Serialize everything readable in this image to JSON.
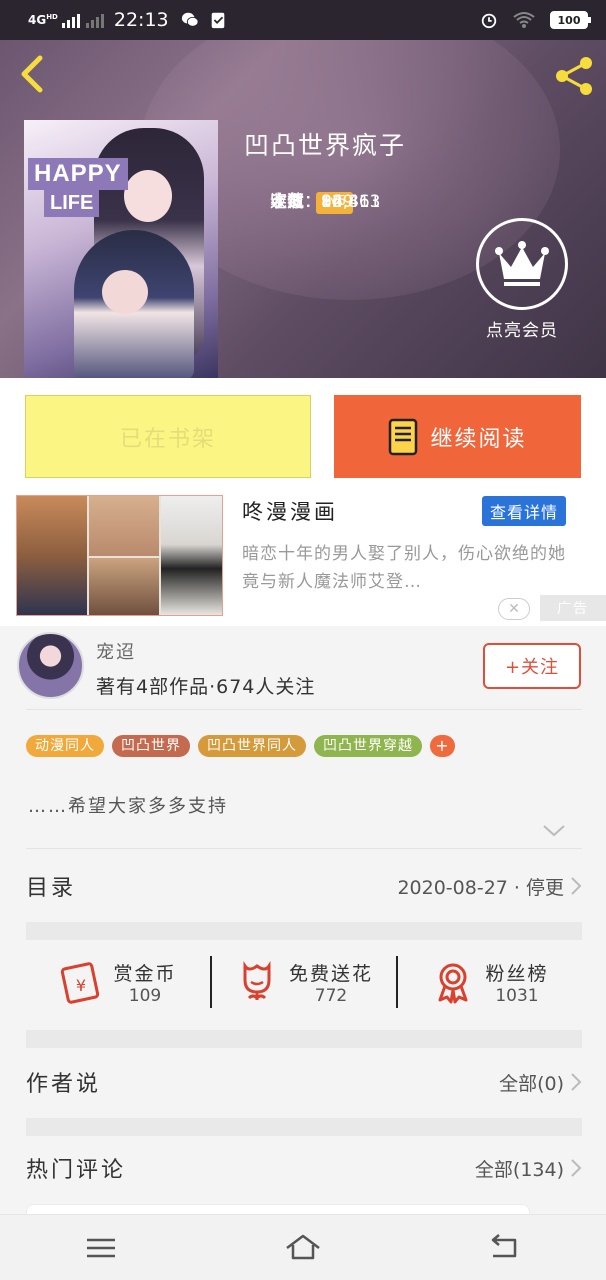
{
  "status_bar": {
    "network": "4G",
    "network_sup": "HD",
    "time": "22:13",
    "battery": "100"
  },
  "book": {
    "title": "凹凸世界疯子",
    "author": "宠迢",
    "level": "Lv5",
    "status": "连载",
    "popularity_label": "人气：",
    "popularity": "86,863",
    "words_label": "字数：",
    "words": "14,411",
    "favorites_label": "收藏：",
    "favorites": "929",
    "cover_text_1": "HAPPY",
    "cover_text_2": "LIFE"
  },
  "vip": {
    "label": "点亮会员"
  },
  "actions": {
    "shelf_label": "已在书架",
    "read_label": "继续阅读"
  },
  "ad": {
    "title": "咚漫漫画",
    "detail_label": "查看详情",
    "description": "暗恋十年的男人娶了别人，伤心欲绝的她竟与新人魔法师艾登…",
    "tag": "广告",
    "close": "✕"
  },
  "author_card": {
    "name": "宠迢",
    "stats": "著有4部作品·674人关注",
    "follow_label": "+关注"
  },
  "tags": [
    {
      "label": "动漫同人",
      "color": "#f2a93b"
    },
    {
      "label": "凹凸世界",
      "color": "#c46a4e"
    },
    {
      "label": "凹凸世界同人",
      "color": "#d59a3a"
    },
    {
      "label": "凹凸世界穿越",
      "color": "#8fb54e"
    },
    {
      "label": "+",
      "color": "#ef6a3d"
    }
  ],
  "intro": "……希望大家多多支持",
  "catalog": {
    "label": "目录",
    "value": "2020-08-27 · 停更"
  },
  "stats": [
    {
      "name": "赏金币",
      "value": "109",
      "icon": "red-envelope-icon"
    },
    {
      "name": "免费送花",
      "value": "772",
      "icon": "flower-icon"
    },
    {
      "name": "粉丝榜",
      "value": "1031",
      "icon": "medal-icon"
    }
  ],
  "author_notes": {
    "label": "作者说",
    "value": "全部(0)"
  },
  "hot_comments": {
    "label": "热门评论",
    "value": "全部(134)"
  },
  "colors": {
    "accent_orange": "#f0663a",
    "shelf_yellow": "#fbf583",
    "follow_red": "#e04e3a",
    "detail_blue": "#2a73d8",
    "level_gold": "#f4b23a"
  }
}
